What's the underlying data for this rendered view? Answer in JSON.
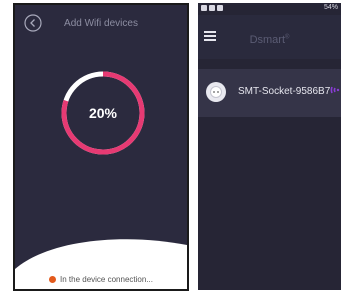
{
  "left": {
    "title": "Add Wifi devices",
    "progress_text": "20%",
    "progress": 0.2,
    "status_text": "In the device connection...",
    "ring_color": "#e63a73",
    "track_color": "#ffffff",
    "dot_color": "#e35a1c",
    "icons": {
      "back": "back-circle-icon"
    }
  },
  "right": {
    "status_bar": {
      "battery": "54%"
    },
    "header": {
      "brand": "Dsmart",
      "brand_mark": "®"
    },
    "devices": [
      {
        "name": "SMT-Socket-9586B7",
        "icon": "socket-icon",
        "signal_icon": "wifi-icon"
      }
    ],
    "icons": {
      "menu": "menu-icon"
    },
    "wifi_color": "#8a3dd6"
  }
}
